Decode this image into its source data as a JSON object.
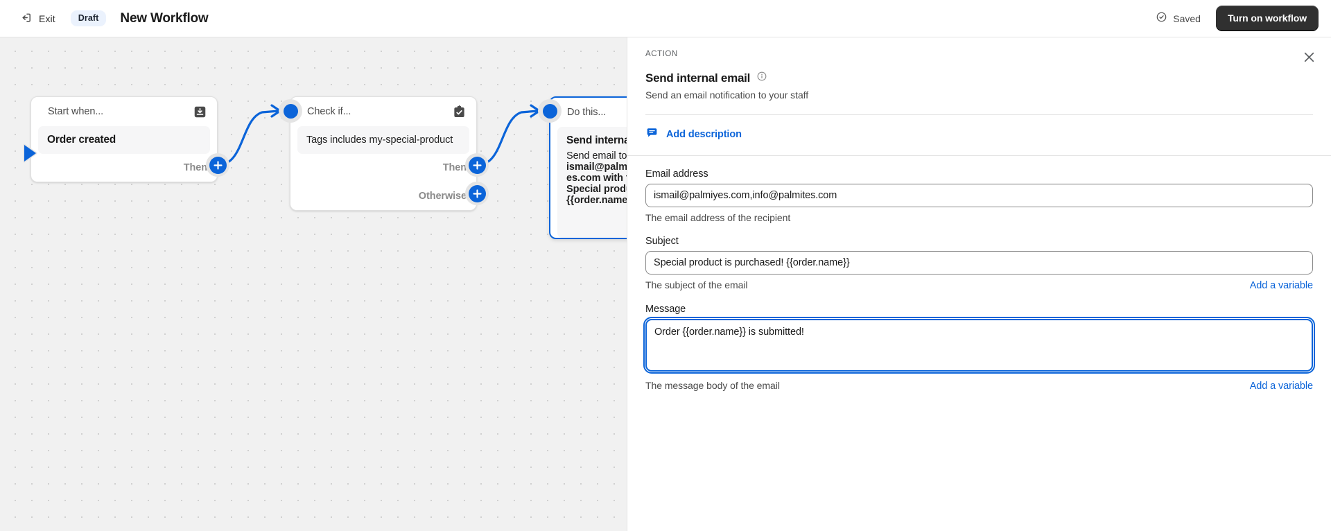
{
  "topbar": {
    "exit_label": "Exit",
    "status_badge": "Draft",
    "workflow_title": "New Workflow",
    "saved_label": "Saved",
    "turn_on_label": "Turn on workflow",
    "accent_color": "#0b64d9",
    "dark_button_color": "#303030"
  },
  "canvas": {
    "nodes": [
      {
        "head_title": "Start when...",
        "head_icon": "download-box-icon",
        "body_title": "Order created",
        "handle": "trigger-arrow",
        "branches": [
          {
            "label": "Then",
            "plus": "add-step-button"
          }
        ]
      },
      {
        "head_title": "Check if...",
        "head_icon": "clipboard-check-icon",
        "body_title": "Tags includes my-special-product",
        "handle": "circle-node",
        "branches": [
          {
            "label": "Then",
            "plus": "add-step-button"
          },
          {
            "label": "Otherwise",
            "plus": "add-step-button"
          }
        ]
      },
      {
        "head_title": "Do this...",
        "head_icon": "",
        "body_title": "Send internal email",
        "body_line1": "Send email to",
        "body_line2": "ismail@palmiyes.com,info@palmit",
        "body_line3": "es.com with the subject",
        "body_line4": "Special product is purchased!",
        "body_line5": "{{order.name}}",
        "handle": "circle-node",
        "branches": []
      }
    ]
  },
  "panel": {
    "kicker": "ACTION",
    "title": "Send internal email",
    "info_icon": "info-circle-icon",
    "subtitle": "Send an email notification to your staff",
    "close_icon": "close-icon",
    "add_description": {
      "icon": "comment-icon",
      "label": "Add description"
    },
    "fields": [
      {
        "label": "Email address",
        "value": "ismail@palmiyes.com,info@palmites.com",
        "placeholder": "",
        "help": "The email address of the recipient",
        "variable_link": ""
      },
      {
        "label": "Subject",
        "value": "Special product is purchased! {{order.name}}",
        "placeholder": "",
        "help": "The subject of the email",
        "variable_link": "Add a variable"
      },
      {
        "label": "Message",
        "value": "Order {{order.name}} is submitted!",
        "placeholder": "",
        "help": "The message body of the email",
        "variable_link": "Add a variable"
      }
    ]
  }
}
